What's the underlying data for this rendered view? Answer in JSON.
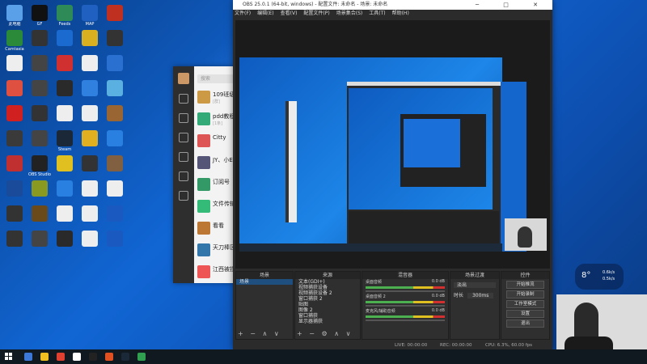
{
  "obs": {
    "title": "OBS 25.0.1 (64-bit, windows) - 配置文件: 未命名 - 场景: 未命名",
    "window_controls": "─ □ ✕",
    "menu": [
      "文件(F)",
      "编辑(E)",
      "查看(V)",
      "配置文件(P)",
      "场景集合(S)",
      "工具(T)",
      "帮助(H)"
    ],
    "docks": {
      "scenes": {
        "header": "场景",
        "items": [
          "场景"
        ]
      },
      "sources": {
        "header": "来源",
        "items": [
          "文本(GDI+)",
          "视频捕获设备",
          "视频捕获设备 2",
          "窗口捕获 2",
          "贴图",
          "图像 2",
          "窗口捕获",
          "显示器捕获"
        ]
      },
      "mixer": {
        "header": "混音器",
        "channels": [
          {
            "label": "桌面音频",
            "level": "0.0 dB"
          },
          {
            "label": "桌面音频 2",
            "level": "0.0 dB"
          },
          {
            "label": "麦克风/辅助音频",
            "level": "0.0 dB"
          }
        ]
      },
      "transitions": {
        "header": "场景过渡",
        "mode": "淡出",
        "duration_label": "时长",
        "duration": "300ms"
      },
      "controls": {
        "header": "控件",
        "buttons": [
          "开始推流",
          "开始录制",
          "工作室模式",
          "设置",
          "退出"
        ]
      }
    },
    "status": {
      "live": "LIVE: 00:00:00",
      "rec": "REC: 00:00:00",
      "cpu": "CPU: 6.3%, 60.00 fps"
    }
  },
  "chat": {
    "search_placeholder": "搜索",
    "conversations": [
      {
        "name": "109班级",
        "sub": "[群]"
      },
      {
        "name": "pdd教程",
        "sub": "[1条]"
      },
      {
        "name": "Citty",
        "sub": ""
      },
      {
        "name": "JY、小EEE",
        "sub": ""
      },
      {
        "name": "订阅号",
        "sub": ""
      },
      {
        "name": "文件传输助手",
        "sub": ""
      },
      {
        "name": "看看",
        "sub": ""
      },
      {
        "name": "天刀棒区",
        "sub": ""
      },
      {
        "name": "江西被拐",
        "sub": ""
      }
    ]
  },
  "weather": {
    "temp": "8°",
    "v1": "0.6k/s",
    "v2": "0.5k/s"
  },
  "desktop": {
    "icons": [
      {
        "label": "此电脑",
        "color": "#5aa0e8"
      },
      {
        "label": "GF",
        "color": "#111111"
      },
      {
        "label": "Feeds",
        "color": "#2e8b57"
      },
      {
        "label": "MAP",
        "color": "#2060c0"
      },
      {
        "label": "",
        "color": "#c03020"
      },
      {
        "label": "Camtasia",
        "color": "#2a8a3a"
      },
      {
        "label": "",
        "color": "#333333"
      },
      {
        "label": "",
        "color": "#1a6ad0"
      },
      {
        "label": "",
        "color": "#d8b020"
      },
      {
        "label": "",
        "color": "#333333"
      },
      {
        "label": "",
        "color": "#eeeeee"
      },
      {
        "label": "",
        "color": "#444444"
      },
      {
        "label": "",
        "color": "#d03030"
      },
      {
        "label": "",
        "color": "#eeeeee"
      },
      {
        "label": "",
        "color": "#2a70d0"
      },
      {
        "label": "",
        "color": "#e05040"
      },
      {
        "label": "",
        "color": "#444444"
      },
      {
        "label": "",
        "color": "#2a2a2a"
      },
      {
        "label": "",
        "color": "#3080e0"
      },
      {
        "label": "",
        "color": "#5ab0e0"
      },
      {
        "label": "",
        "color": "#d02020"
      },
      {
        "label": "",
        "color": "#333333"
      },
      {
        "label": "",
        "color": "#eeeeee"
      },
      {
        "label": "",
        "color": "#eeeeee"
      },
      {
        "label": "",
        "color": "#996633"
      },
      {
        "label": "",
        "color": "#3a3a3a"
      },
      {
        "label": "",
        "color": "#444444"
      },
      {
        "label": "Steam",
        "color": "#1b2838"
      },
      {
        "label": "",
        "color": "#e0b020"
      },
      {
        "label": "",
        "color": "#2a80e0"
      },
      {
        "label": "",
        "color": "#c03030"
      },
      {
        "label": "OBS Studio",
        "color": "#222222"
      },
      {
        "label": "",
        "color": "#e0c020"
      },
      {
        "label": "",
        "color": "#333333"
      },
      {
        "label": "",
        "color": "#806040"
      },
      {
        "label": "",
        "color": "#1a4a9a"
      },
      {
        "label": "",
        "color": "#8a9a20"
      },
      {
        "label": "",
        "color": "#2a80e0"
      },
      {
        "label": "",
        "color": "#eeeeee"
      },
      {
        "label": "",
        "color": "#eeeeee"
      },
      {
        "label": "",
        "color": "#333333"
      },
      {
        "label": "",
        "color": "#6a4a1a"
      },
      {
        "label": "",
        "color": "#eeeeee"
      },
      {
        "label": "",
        "color": "#eeeeee"
      },
      {
        "label": "",
        "color": "#1a5ac0"
      },
      {
        "label": "",
        "color": "#333333"
      },
      {
        "label": "",
        "color": "#444444"
      },
      {
        "label": "",
        "color": "#2a2a2a"
      },
      {
        "label": "",
        "color": "#eeeeee"
      },
      {
        "label": "",
        "color": "#1a5ac0"
      }
    ]
  },
  "taskbar": {
    "icons": [
      "#3b78d8",
      "#f0c020",
      "#e04030",
      "#ffffff",
      "#222222",
      "#e05020",
      "#1b2838",
      "#30a050"
    ]
  }
}
